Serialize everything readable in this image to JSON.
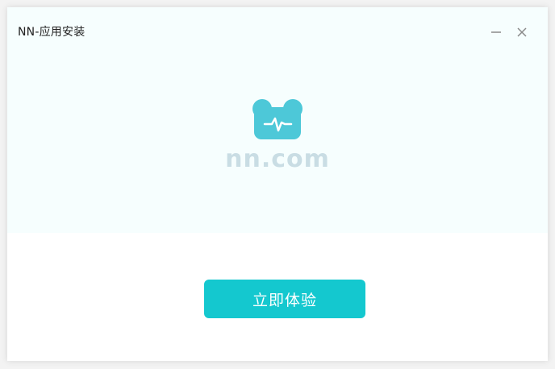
{
  "window": {
    "title": "NN-应用安装",
    "minimize_icon": "minimize-icon",
    "close_icon": "close-icon"
  },
  "hero": {
    "logo_icon": "bear-pulse-logo-icon",
    "wordmark": "nn.com",
    "background_color": "#f6fefe"
  },
  "actions": {
    "primary_label": "立即体验",
    "primary_color": "#14c8cf"
  },
  "colors": {
    "logo": "#4dc8d8",
    "wordmark": "#c9dde4"
  }
}
